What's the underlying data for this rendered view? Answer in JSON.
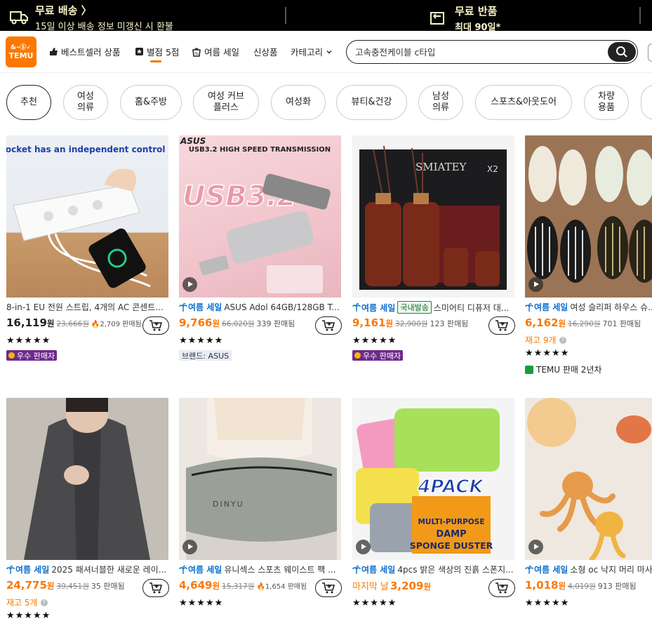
{
  "banner": {
    "free_shipping_title": "무료 배송 〉",
    "free_shipping_sub": "15일 이상 배송 정보 미갱신 시 환불",
    "free_return_title": "무료 반품",
    "free_return_sub": "최대 90일*"
  },
  "logo": {
    "line1": "&⌁Ⓢ✓",
    "line2": "TEMU"
  },
  "nav": {
    "bestseller": "베스트셀러 상품",
    "five_star": "별점 5점",
    "summer_sale": "여름 세일",
    "new": "신상품",
    "category": "카테고리",
    "search_placeholder": "고속충전케이블 c타입"
  },
  "categories": [
    "추천",
    "여성\n의류",
    "홈&주방",
    "여성 커브\n플러스",
    "여성화",
    "뷰티&건강",
    "남성\n의류",
    "스포츠&아웃도어",
    "차량\n용품"
  ],
  "products": [
    {
      "title": "8-in-1 EU 전원 스트립, 4개의 AC 콘센트...",
      "price": "16,119",
      "won": "원",
      "orig": "23,666원",
      "sold": "2,709 판매됨",
      "fire": "🔥",
      "stars": "★★★★★",
      "badge": "우수 판매자",
      "img_text": "Each socket has an independent control switch"
    },
    {
      "sale": "여름 세일",
      "title": "ASUS Adol 64GB/128GB Type...",
      "price": "9,766",
      "won": "원",
      "orig": "66,020원",
      "sold": "339 판매됨",
      "stars": "★★★★★",
      "brand": "브랜드: ASUS",
      "img_text": "USB3.2 HIGH SPEED TRANSMISSION",
      "img_logo": "ASUS",
      "img_big": "USB3.2"
    },
    {
      "sale": "여름 세일",
      "domestic": "국내발송",
      "title": "스미어티 디퓨저 대...",
      "price": "9,161",
      "won": "원",
      "orig": "32,900원",
      "sold": "123 판매됨",
      "stars": "★★★★★",
      "badge": "우수 판매자",
      "img_text": "SMIATEY",
      "img_x2": "X2"
    },
    {
      "sale": "여름 세일",
      "title": "여성 슬리퍼 하우스 슈...",
      "price": "6,162",
      "won": "원",
      "orig": "16,290원",
      "sold": "701 판매됨",
      "stock": "재고 9개",
      "stars": "★★★★★",
      "seller": "TEMU 판매 2년차"
    },
    {
      "sale": "여름 세일",
      "title": "2025 패셔너블한 새로운 레이...",
      "price": "24,775",
      "won": "원",
      "orig": "39,451원",
      "sold": "35 판매됨",
      "stock": "재고 5개",
      "stars": "★★★★★"
    },
    {
      "sale": "여름 세일",
      "title": "유니섹스 스포츠 웨이스트 팩 ...",
      "price": "4,649",
      "won": "원",
      "orig": "15,317원",
      "sold": "1,654 판매됨",
      "fire": "🔥",
      "stars": "★★★★★",
      "img_text": "DINYU"
    },
    {
      "sale": "여름 세일",
      "title": "4pcs 밝은 색상의 진흙 스폰지...",
      "lastday": "마지막 날",
      "price": "3,209",
      "won": "원",
      "stars": "★★★★★",
      "img_big": "4PACK",
      "img_l1": "MULTI-PURPOSE",
      "img_l2": "DAMP",
      "img_l3": "SPONGE DUSTER"
    },
    {
      "sale": "여름 세일",
      "title": "소형 oc 낙지 머리 마사지...",
      "price": "1,018",
      "won": "원",
      "orig": "4,019원",
      "sold": "913 판매됨",
      "stars": "★★★★★"
    }
  ],
  "colors": {
    "accent": "#fb7701",
    "badge": "#6e2a8e",
    "sale_blue": "#0a6fcf"
  }
}
